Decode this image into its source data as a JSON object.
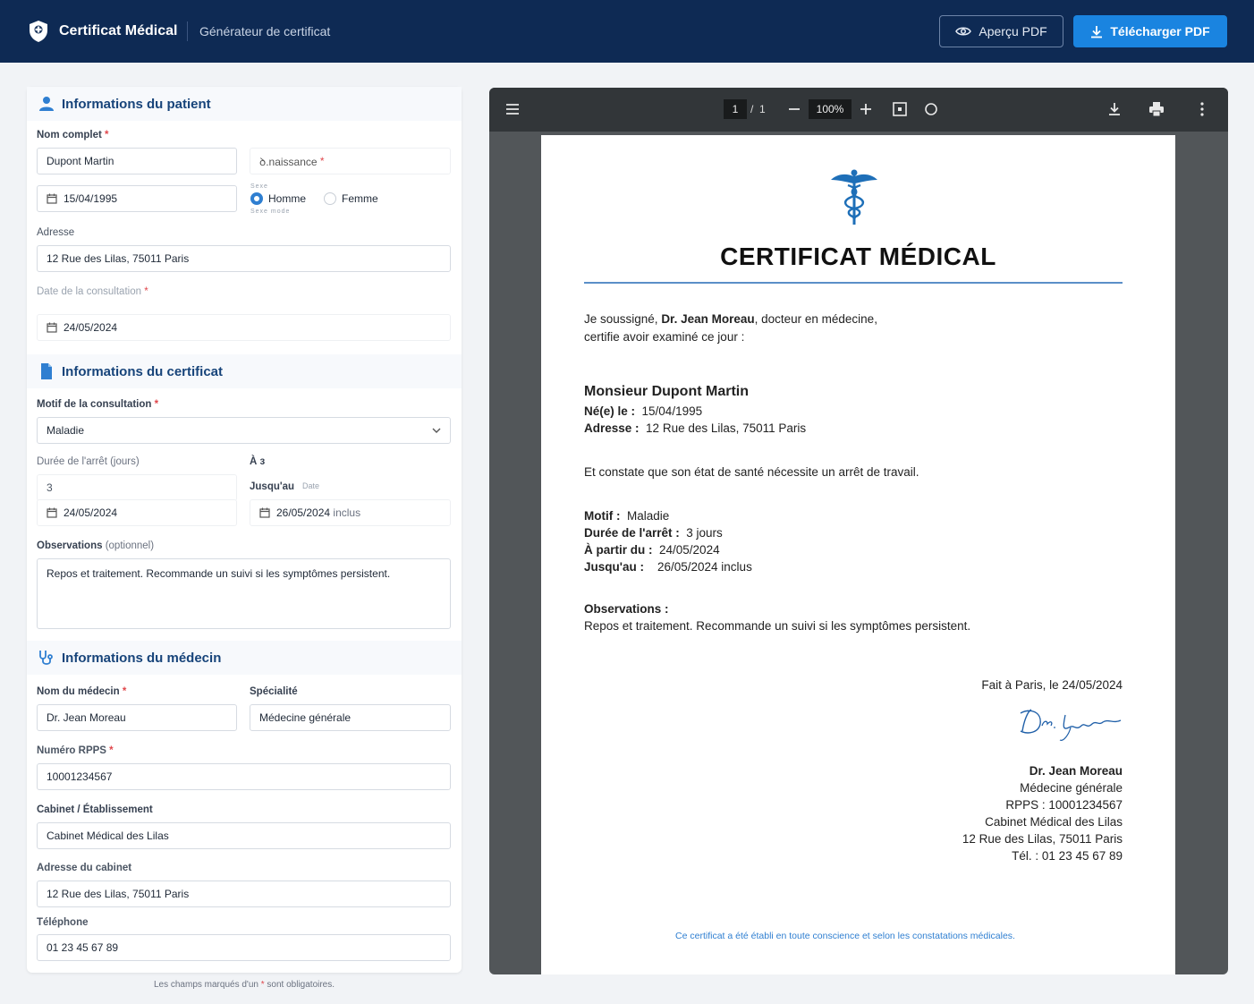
{
  "header": {
    "title": "Certificat Médical",
    "subtitle": "Générateur de certificat",
    "preview_label": "Aperçu PDF",
    "download_label": "Télécharger PDF"
  },
  "form": {
    "patient": {
      "section_title": "Informations du patient",
      "name_label": "Nom complet",
      "name_value": "Dupont Martin",
      "birth_label": "ꝺ.naissance",
      "birth_value": "15/04/1995",
      "sex_label_top": "Sexe",
      "sex_label_bottom": "Sexe mode",
      "sex_options": [
        "Homme",
        "Femme"
      ],
      "sex_selected": "Homme",
      "address_label": "Adresse",
      "address_value": "12 Rue des Lilas, 75011 Paris",
      "consult_date_label": "Date de la consultation",
      "consult_date_value": "24/05/2024"
    },
    "certificate": {
      "section_title": "Informations du certificat",
      "reason_label": "Motif de la consultation",
      "reason_value": "Maladie",
      "duration_label": "Durée de l'arrêt (jours)",
      "from_label": "À з",
      "duration_value": "3",
      "until_label": "Jusqu'au",
      "until_suffix_label": "Date",
      "from_value": "24/05/2024",
      "until_value": "26/05/2024",
      "until_inclus": "inclus",
      "obs_label": "Observations",
      "obs_optional": "(optionnel)",
      "obs_value": "Repos et traitement. Recommande un suivi si les symptômes persistent."
    },
    "doctor": {
      "section_title": "Informations du médecin",
      "name_label": "Nom du médecin",
      "name_value": "Dr. Jean Moreau",
      "specialty_label": "Spécialité",
      "specialty_value": "Médecine générale",
      "rpps_label": "Numéro RPPS",
      "rpps_value": "10001234567",
      "cabinet_label": "Cabinet / Établissement",
      "cabinet_value": "Cabinet Médical des Lilas",
      "cabinet_address_label": "Adresse du cabinet",
      "cabinet_address_value": "12 Rue des Lilas, 75011 Paris",
      "phone_label": "Téléphone",
      "phone_value": "01 23 45 67 89"
    },
    "required_mark": "*",
    "footnote_before": "Les champs marqués d'un ",
    "footnote_after": " sont obligatoires."
  },
  "viewer": {
    "page_current": "1",
    "page_sep": "/",
    "page_total": "1",
    "zoom": "100%"
  },
  "document": {
    "title": "CERTIFICAT MÉDICAL",
    "intro_1_pre": "Je soussigné, ",
    "intro_1_doctor": "Dr. Jean Moreau",
    "intro_1_post": ", docteur en médecine,",
    "intro_2": "certifie avoir examiné ce jour :",
    "patient_name": "Monsieur Dupont Martin",
    "born_label": "Né(e) le :",
    "born_value": "15/04/1995",
    "address_label": "Adresse :",
    "address_value": "12 Rue des Lilas, 75011 Paris",
    "statement": "Et constate que son état de santé nécessite un arrêt de travail.",
    "motif_label": "Motif :",
    "motif_value": "Maladie",
    "duree_label": "Durée de l'arrêt :",
    "duree_value": "3 jours",
    "partir_label": "À partir du :",
    "partir_value": "24/05/2024",
    "jusquau_label": "Jusqu'au :",
    "jusquau_value": "26/05/2024 inclus",
    "obs_label": "Observations :",
    "obs_value": "Repos et traitement. Recommande un suivi si les symptômes persistent.",
    "fait_a": "Fait à Paris, le 24/05/2024",
    "sig_doctor": "Dr. Jean Moreau",
    "sig_specialty": "Médecine générale",
    "sig_rpps": "RPPS : 10001234567",
    "sig_cabinet": "Cabinet Médical des Lilas",
    "sig_address": "12 Rue des Lilas, 75011 Paris",
    "sig_phone": "Tél. : 01 23 45 67 89",
    "footer": "Ce certificat a été établi en toute conscience et selon les constatations médicales."
  },
  "colors": {
    "navy": "#0e2a54",
    "accent": "#1a84e0",
    "section_title": "#17447a",
    "required": "#e0474c"
  }
}
